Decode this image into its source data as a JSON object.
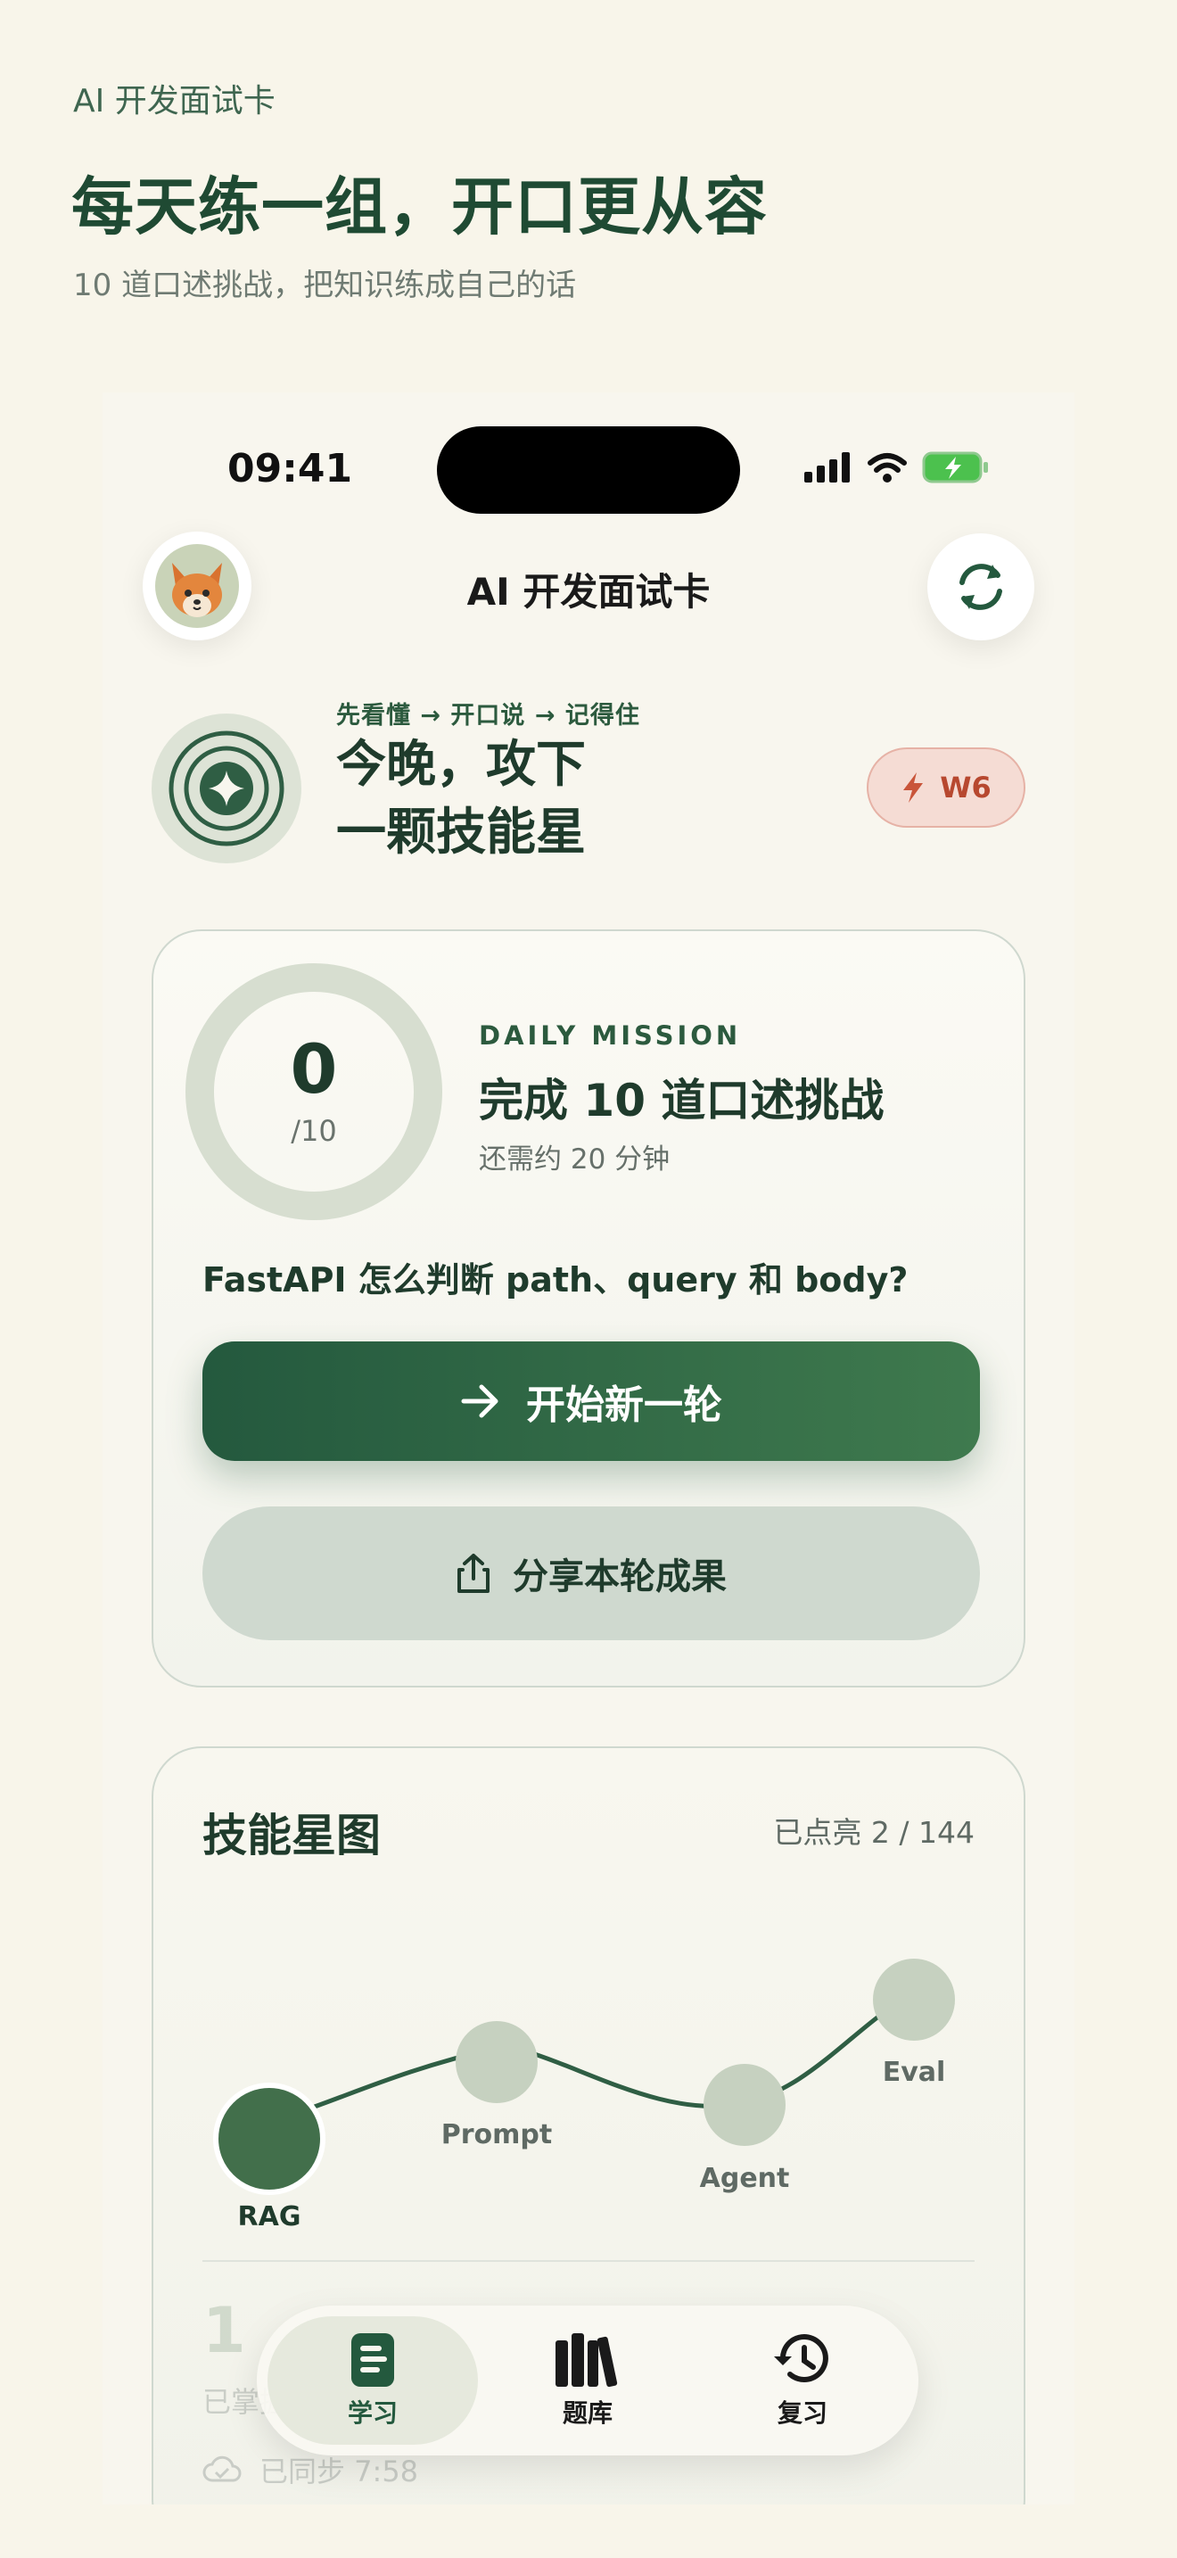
{
  "intro": {
    "eyebrow": "AI 开发面试卡",
    "headline": "每天练一组，开口更从容",
    "subline": "10 道口述挑战，把知识练成自己的话"
  },
  "status_bar": {
    "time": "09:41",
    "icons": [
      "signal-icon",
      "wifi-icon",
      "battery-charging-icon"
    ]
  },
  "header": {
    "title": "AI 开发面试卡",
    "avatar_icon": "fox-avatar-icon",
    "refresh_icon": "refresh-icon"
  },
  "hero": {
    "steps": "先看懂 → 开口说 → 记得住",
    "title_line1": "今晚，攻下",
    "title_line2": "一颗技能星",
    "badge_icon": "sparkle-target-icon",
    "week_label": "W6",
    "week_icon": "bolt-icon"
  },
  "mission": {
    "progress_value": "0",
    "progress_total": "/10",
    "progress_fraction": 0,
    "kicker": "DAILY MISSION",
    "title": "完成 10 道口述挑战",
    "subtitle": "还需约 20 分钟",
    "question": "FastAPI 怎么判断 path、query 和 body?",
    "primary_button": "开始新一轮",
    "secondary_button": "分享本轮成果"
  },
  "skills": {
    "title": "技能星图",
    "lit_count": "已点亮 2 / 144",
    "nodes": [
      {
        "label": "RAG",
        "state": "active"
      },
      {
        "label": "Prompt",
        "state": "locked"
      },
      {
        "label": "Agent",
        "state": "locked"
      },
      {
        "label": "Eval",
        "state": "locked"
      }
    ],
    "stat_number": "1",
    "stat_label": "已掌握",
    "sync_text": "已同步 7:58"
  },
  "tabs": [
    {
      "label": "学习",
      "icon": "document-icon",
      "active": true
    },
    {
      "label": "题库",
      "icon": "books-icon",
      "active": false
    },
    {
      "label": "复习",
      "icon": "history-icon",
      "active": false
    }
  ],
  "colors": {
    "primary": "#24593e",
    "accent_soft": "#cfd9cf",
    "week_pill": "#f5dcd4",
    "background": "#f8f5ea"
  }
}
